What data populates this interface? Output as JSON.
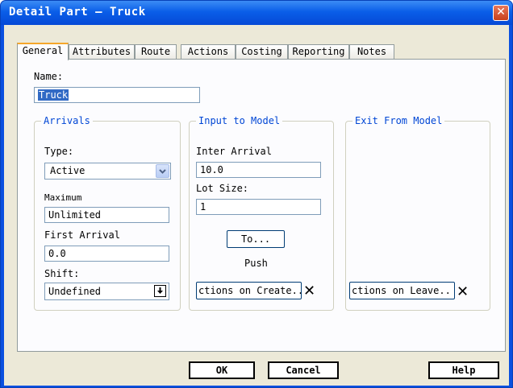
{
  "window": {
    "title": "Detail Part – Truck"
  },
  "tabs": [
    "General",
    "Attributes",
    "Route",
    "Actions",
    "Costing",
    "Reporting",
    "Notes"
  ],
  "name": {
    "label": "Name:",
    "value": "Truck"
  },
  "arrivals": {
    "legend": "Arrivals",
    "type_label": "Type:",
    "type_value": "Active",
    "maximum_label": "Maximum",
    "maximum_value": "Unlimited",
    "first_label": "First Arrival",
    "first_value": "0.0",
    "shift_label": "Shift:",
    "shift_value": "Undefined"
  },
  "input_model": {
    "legend": "Input to Model",
    "inter_label": "Inter Arrival",
    "inter_value": "10.0",
    "lot_label": "Lot Size:",
    "lot_value": "1",
    "to_button": "To...",
    "push_label": "Push",
    "create_button": "ctions on Create..",
    "x_mark": "✕"
  },
  "exit_model": {
    "legend": "Exit From Model",
    "leave_button": "ctions on Leave..",
    "x_mark": "✕"
  },
  "buttons": {
    "ok": "OK",
    "cancel": "Cancel",
    "help": "Help"
  },
  "icons": {
    "close": "close-icon",
    "dropdown": "chevron-down-icon",
    "shift": "down-arrow-icon"
  }
}
